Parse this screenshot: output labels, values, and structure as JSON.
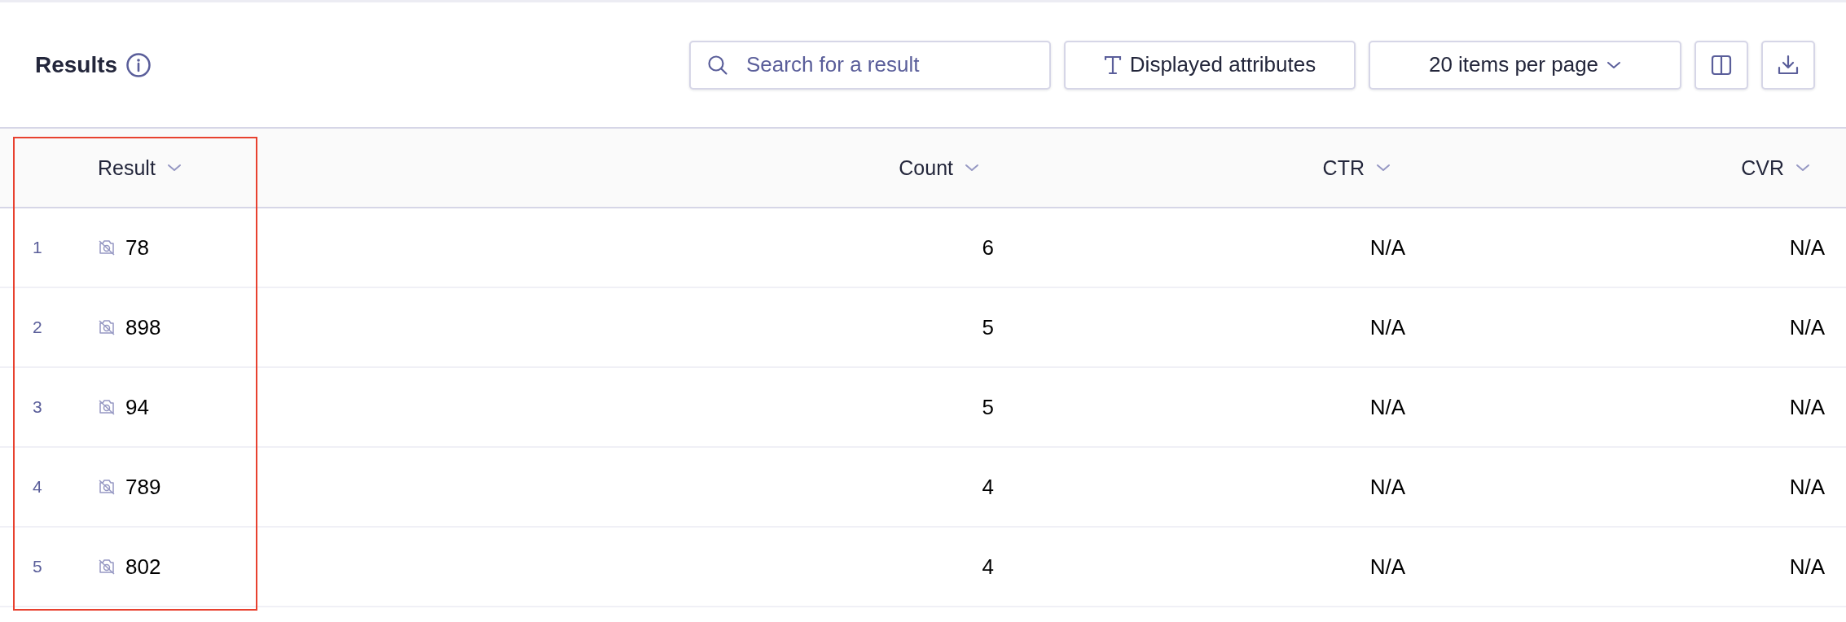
{
  "header": {
    "title": "Results",
    "search": {
      "placeholder": "Search for a result"
    },
    "attributes_button": "Displayed attributes",
    "page_size": "20 items per page"
  },
  "table": {
    "columns": [
      {
        "label": "Result",
        "highlighted": true
      },
      {
        "label": "Count",
        "highlighted": false
      },
      {
        "label": "CTR",
        "highlighted": false
      },
      {
        "label": "CVR",
        "highlighted": false
      }
    ],
    "rows": [
      {
        "index": "1",
        "result": "78",
        "count": "6",
        "ctr": "N/A",
        "cvr": "N/A"
      },
      {
        "index": "2",
        "result": "898",
        "count": "5",
        "ctr": "N/A",
        "cvr": "N/A"
      },
      {
        "index": "3",
        "result": "94",
        "count": "5",
        "ctr": "N/A",
        "cvr": "N/A"
      },
      {
        "index": "4",
        "result": "789",
        "count": "4",
        "ctr": "N/A",
        "cvr": "N/A"
      },
      {
        "index": "5",
        "result": "802",
        "count": "4",
        "ctr": "N/A",
        "cvr": "N/A"
      }
    ]
  }
}
